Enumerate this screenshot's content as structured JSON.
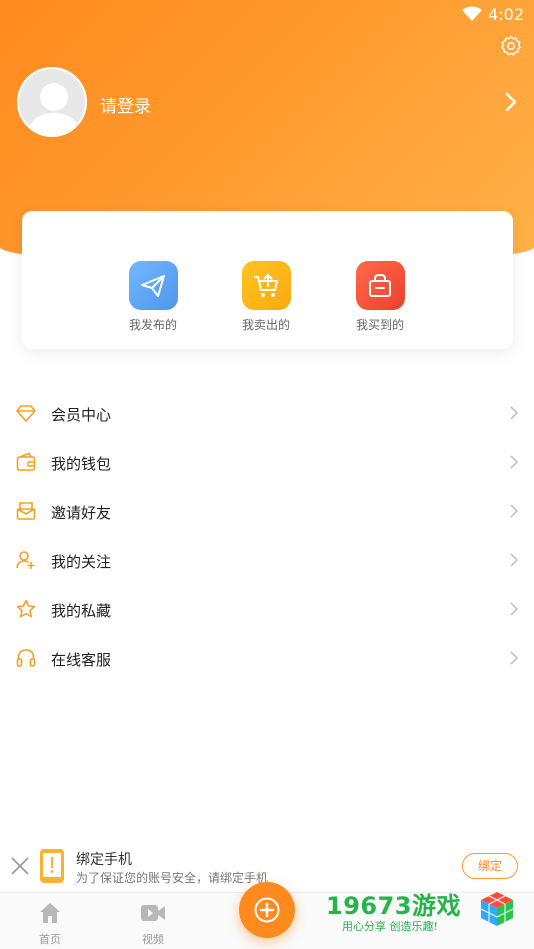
{
  "status": {
    "time": "4:02"
  },
  "header": {
    "login_text": "请登录"
  },
  "quick_actions": [
    {
      "label": "我发布的",
      "icon": "paper-plane-icon",
      "color": "#5aa8f5"
    },
    {
      "label": "我卖出的",
      "icon": "cart-upload-icon",
      "color": "#ffb020"
    },
    {
      "label": "我买到的",
      "icon": "shopping-bag-icon",
      "color": "#f4553a"
    }
  ],
  "menu": [
    {
      "label": "会员中心",
      "icon": "diamond-icon"
    },
    {
      "label": "我的钱包",
      "icon": "wallet-icon"
    },
    {
      "label": "邀请好友",
      "icon": "envelope-icon"
    },
    {
      "label": "我的关注",
      "icon": "user-plus-icon"
    },
    {
      "label": "我的私藏",
      "icon": "star-icon"
    },
    {
      "label": "在线客服",
      "icon": "headset-icon"
    }
  ],
  "bind_phone": {
    "title": "绑定手机",
    "description": "为了保证您的账号安全，请绑定手机",
    "button": "绑定"
  },
  "tabbar": [
    {
      "label": "首页",
      "icon": "home-icon"
    },
    {
      "label": "视频",
      "icon": "video-icon"
    }
  ],
  "watermark": {
    "title": "19673游戏",
    "subtitle": "用心分享 创造乐趣!"
  },
  "colors": {
    "accent": "#ff8a1e",
    "icon_orange": "#f5a020"
  }
}
